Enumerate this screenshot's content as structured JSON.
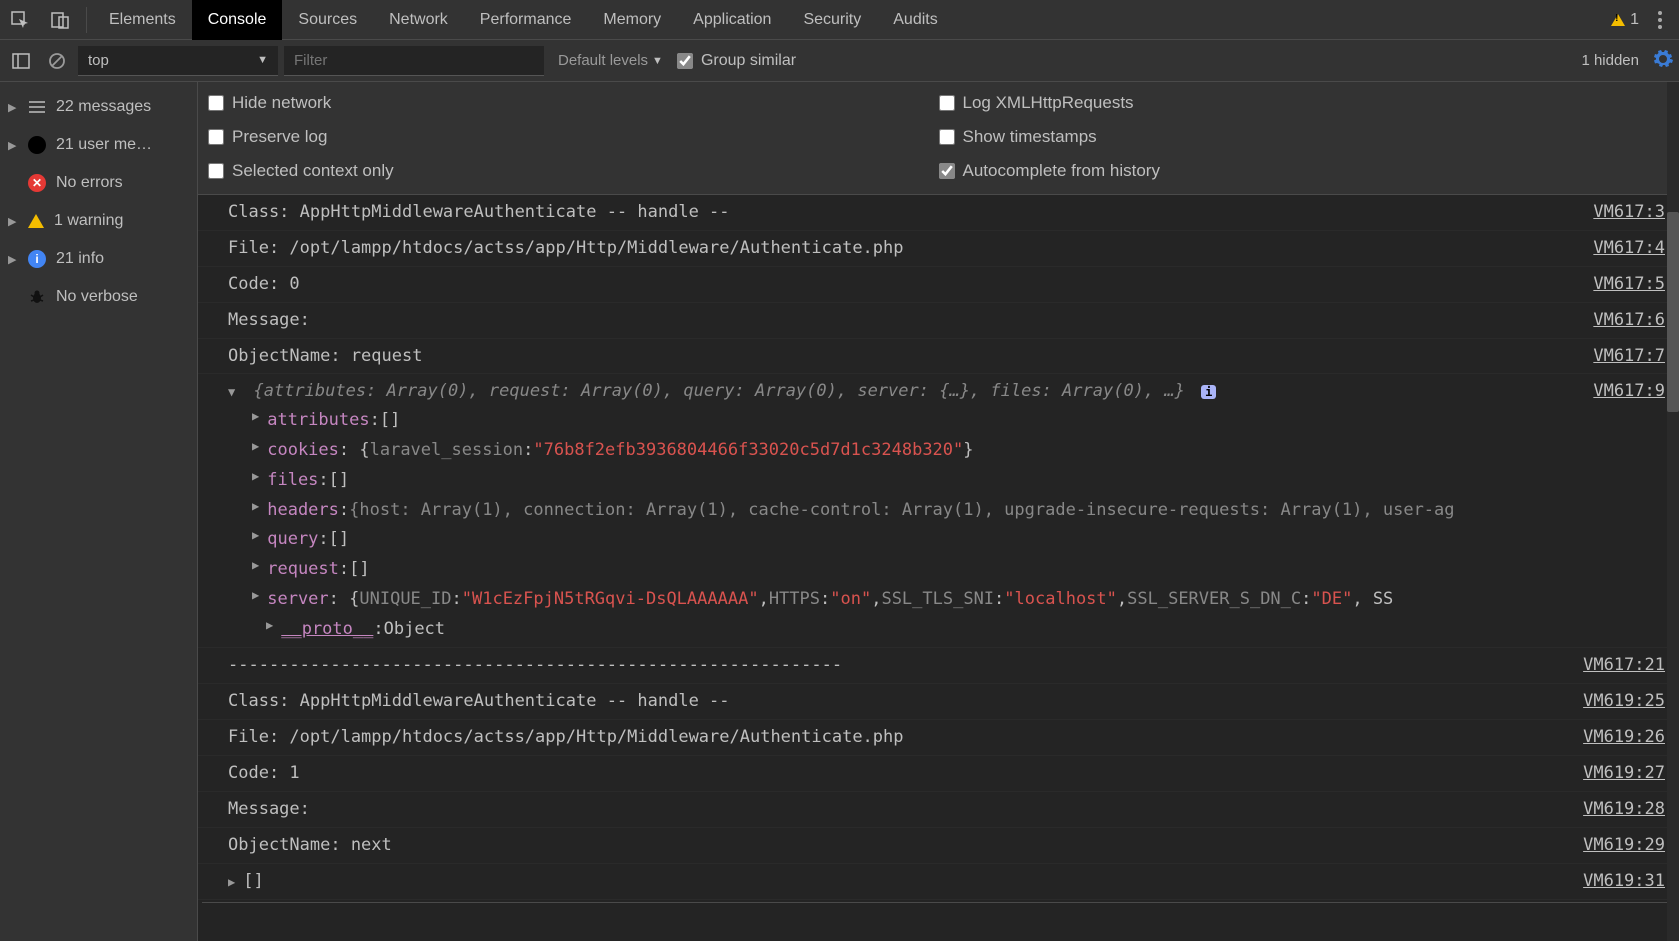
{
  "tabs": [
    "Elements",
    "Console",
    "Sources",
    "Network",
    "Performance",
    "Memory",
    "Application",
    "Security",
    "Audits"
  ],
  "activeTab": "Console",
  "topWarnCount": "1",
  "toolbar": {
    "context": "top",
    "filterPlaceholder": "Filter",
    "levels": "Default levels",
    "groupSimilar": "Group similar",
    "hidden": "1 hidden"
  },
  "sidebar": [
    {
      "icon": "msg",
      "expand": true,
      "label": "22 messages"
    },
    {
      "icon": "user",
      "expand": true,
      "label": "21 user me…"
    },
    {
      "icon": "err",
      "expand": false,
      "label": "No errors"
    },
    {
      "icon": "warn",
      "expand": true,
      "label": "1 warning"
    },
    {
      "icon": "info",
      "expand": true,
      "label": "21 info"
    },
    {
      "icon": "bug",
      "expand": false,
      "label": "No verbose"
    }
  ],
  "settings": {
    "left": [
      {
        "label": "Hide network",
        "checked": false
      },
      {
        "label": "Preserve log",
        "checked": false
      },
      {
        "label": "Selected context only",
        "checked": false
      }
    ],
    "right": [
      {
        "label": "Log XMLHttpRequests",
        "checked": false
      },
      {
        "label": "Show timestamps",
        "checked": false
      },
      {
        "label": "Autocomplete from history",
        "checked": true
      }
    ]
  },
  "logs": {
    "l1": {
      "text": "Class: AppHttpMiddlewareAuthenticate -- handle --",
      "src": "VM617:3"
    },
    "l2": {
      "text": "File: /opt/lampp/htdocs/actss/app/Http/Middleware/Authenticate.php",
      "src": "VM617:4"
    },
    "l3": {
      "text": "Code: 0",
      "src": "VM617:5"
    },
    "l4": {
      "text": "Message:",
      "src": "VM617:6"
    },
    "l5": {
      "text": "ObjectName: request",
      "src": "VM617:7"
    },
    "objSrc": "VM617:9",
    "objHead": "{attributes: Array(0), request: Array(0), query: Array(0), server: {…}, files: Array(0), …}",
    "tree": {
      "attributes": "[]",
      "cookiesKey": "cookies",
      "cookiesInnerKey": "laravel_session",
      "cookiesVal": "\"76b8f2efb3936804466f33020c5d7d1c3248b320\"",
      "files": "[]",
      "headersText": "{host: Array(1), connection: Array(1), cache-control: Array(1), upgrade-insecure-requests: Array(1), user-ag",
      "query": "[]",
      "request": "[]",
      "serverK1": "UNIQUE_ID",
      "serverV1": "\"W1cEzFpjN5tRGqvi-DsQLAAAAAA\"",
      "serverK2": "HTTPS",
      "serverV2": "\"on\"",
      "serverK3": "SSL_TLS_SNI",
      "serverV3": "\"localhost\"",
      "serverK4": "SSL_SERVER_S_DN_C",
      "serverV4": "\"DE\"",
      "proto": "__proto__",
      "protoVal": "Object"
    },
    "dashes": "------------------------------------------------------------",
    "dashesSrc": "VM617:21",
    "l6": {
      "text": "Class: AppHttpMiddlewareAuthenticate -- handle --",
      "src": "VM619:25"
    },
    "l7": {
      "text": "File: /opt/lampp/htdocs/actss/app/Http/Middleware/Authenticate.php",
      "src": "VM619:26"
    },
    "l8": {
      "text": "Code: 1",
      "src": "VM619:27"
    },
    "l9": {
      "text": "Message:",
      "src": "VM619:28"
    },
    "l10": {
      "text": "ObjectName: next",
      "src": "VM619:29"
    },
    "arr2": "[]",
    "arr2Src": "VM619:31"
  }
}
